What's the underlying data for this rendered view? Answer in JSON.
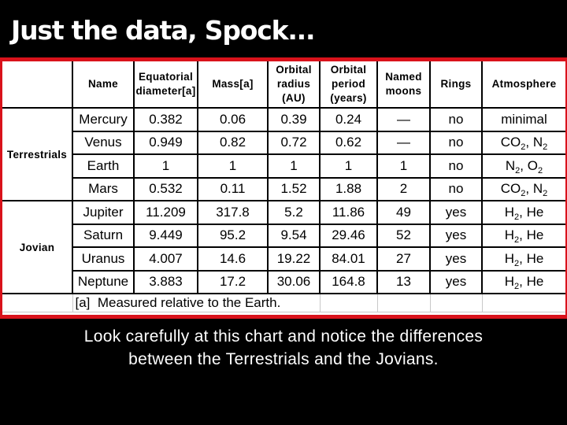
{
  "slide": {
    "title": "Just the data, Spock...",
    "caption_line1": "Look carefully at this chart and notice the differences",
    "caption_line2": "between the Terrestrials and the Jovians."
  },
  "colors": {
    "background": "#000000",
    "accent_border": "#d9121b",
    "table_background": "#ffffff",
    "text_light": "#ffffff",
    "text_dark": "#000000"
  },
  "table": {
    "headers": {
      "group": "",
      "name": "Name",
      "diameter_line1": "Equatorial",
      "diameter_line2": "diameter[a]",
      "mass": "Mass[a]",
      "radius_line1": "Orbital",
      "radius_line2": "radius",
      "radius_line3": "(AU)",
      "period_line1": "Orbital",
      "period_line2": "period",
      "period_line3": "(years)",
      "moons_line1": "Named",
      "moons_line2": "moons",
      "rings": "Rings",
      "atmosphere": "Atmosphere"
    },
    "groups": {
      "terrestrial": "Terrestrials",
      "jovian": "Jovian"
    },
    "rows": [
      {
        "name": "Mercury",
        "diameter": "0.382",
        "mass": "0.06",
        "radius": "0.39",
        "period": "0.24",
        "moons": "—",
        "rings": "no",
        "atm_a": "minimal",
        "atm_a_sub": "",
        "atm_sep": "",
        "atm_b": "",
        "atm_b_sub": ""
      },
      {
        "name": "Venus",
        "diameter": "0.949",
        "mass": "0.82",
        "radius": "0.72",
        "period": "0.62",
        "moons": "—",
        "rings": "no",
        "atm_a": "CO",
        "atm_a_sub": "2",
        "atm_sep": ", ",
        "atm_b": "N",
        "atm_b_sub": "2"
      },
      {
        "name": "Earth",
        "diameter": "1",
        "mass": "1",
        "radius": "1",
        "period": "1",
        "moons": "1",
        "rings": "no",
        "atm_a": "N",
        "atm_a_sub": "2",
        "atm_sep": ", ",
        "atm_b": "O",
        "atm_b_sub": "2"
      },
      {
        "name": "Mars",
        "diameter": "0.532",
        "mass": "0.11",
        "radius": "1.52",
        "period": "1.88",
        "moons": "2",
        "rings": "no",
        "atm_a": "CO",
        "atm_a_sub": "2",
        "atm_sep": ", ",
        "atm_b": "N",
        "atm_b_sub": "2"
      },
      {
        "name": "Jupiter",
        "diameter": "11.209",
        "mass": "317.8",
        "radius": "5.2",
        "period": "11.86",
        "moons": "49",
        "rings": "yes",
        "atm_a": "H",
        "atm_a_sub": "2",
        "atm_sep": ", ",
        "atm_b": "He",
        "atm_b_sub": ""
      },
      {
        "name": "Saturn",
        "diameter": "9.449",
        "mass": "95.2",
        "radius": "9.54",
        "period": "29.46",
        "moons": "52",
        "rings": "yes",
        "atm_a": "H",
        "atm_a_sub": "2",
        "atm_sep": ", ",
        "atm_b": "He",
        "atm_b_sub": ""
      },
      {
        "name": "Uranus",
        "diameter": "4.007",
        "mass": "14.6",
        "radius": "19.22",
        "period": "84.01",
        "moons": "27",
        "rings": "yes",
        "atm_a": "H",
        "atm_a_sub": "2",
        "atm_sep": ", ",
        "atm_b": "He",
        "atm_b_sub": ""
      },
      {
        "name": "Neptune",
        "diameter": "3.883",
        "mass": "17.2",
        "radius": "30.06",
        "period": "164.8",
        "moons": "13",
        "rings": "yes",
        "atm_a": "H",
        "atm_a_sub": "2",
        "atm_sep": ", ",
        "atm_b": "He",
        "atm_b_sub": ""
      }
    ],
    "footnote": "[a]  Measured relative to the Earth."
  }
}
